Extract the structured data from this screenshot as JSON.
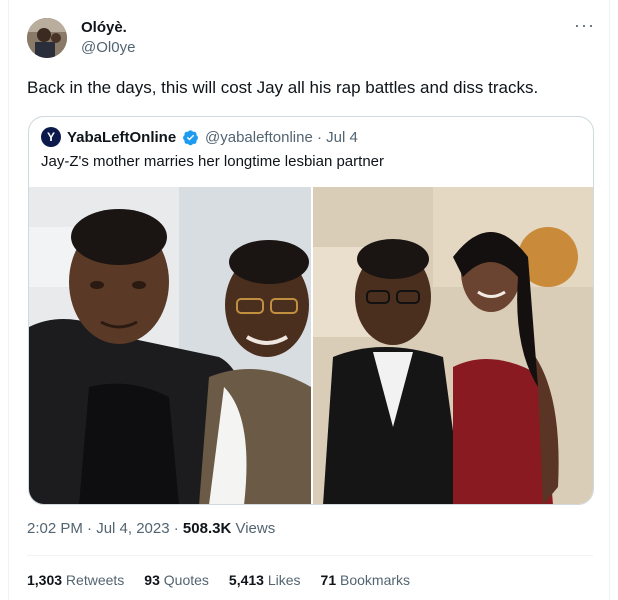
{
  "tweet": {
    "author_name": "Olóyè.",
    "author_handle": "@Ol0ye",
    "more_icon": "more-horizontal-icon",
    "text": "Back in the days, this will cost Jay all his rap battles and diss tracks.",
    "quote": {
      "avatar_letter": "Y",
      "name": "YabaLeftOnline",
      "verified": true,
      "handle_date": "@yabaleftonline · Jul 4",
      "text": "Jay-Z's mother marries her longtime lesbian partner"
    },
    "time": "2:02 PM · Jul 4, 2023 · ",
    "views_count": "508.3K",
    "views_label": " Views"
  },
  "stats": {
    "retweets_count": "1,303",
    "retweets_label": " Retweets",
    "quotes_count": "93",
    "quotes_label": " Quotes",
    "likes_count": "5,413",
    "likes_label": " Likes",
    "bookmarks_count": "71",
    "bookmarks_label": " Bookmarks"
  },
  "colors": {
    "text": "#0f1419",
    "muted": "#536471",
    "border": "#cfd9de",
    "verified": "#1d9bf0"
  }
}
